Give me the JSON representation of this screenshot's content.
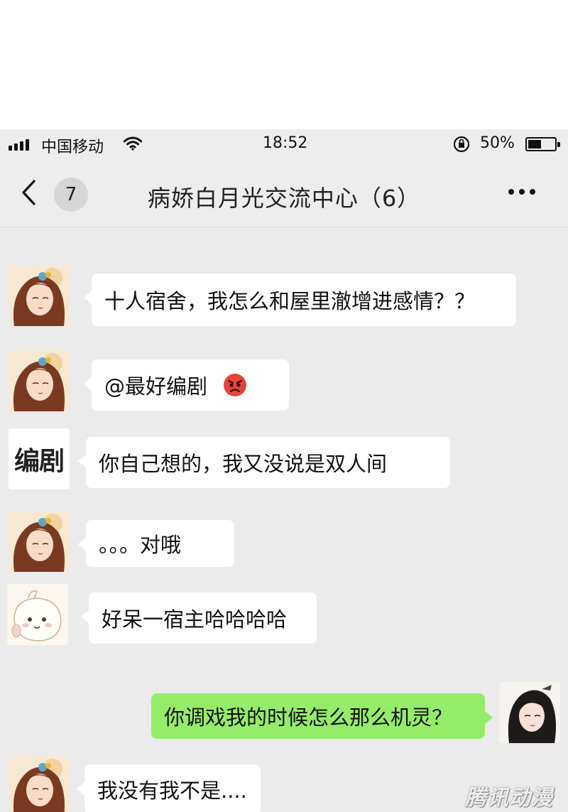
{
  "status_bar": {
    "carrier": "中国移动",
    "time": "18:52",
    "battery": "50%"
  },
  "nav": {
    "unread_count": "7",
    "title": "病娇白月光交流中心（6）"
  },
  "messages": [
    {
      "sender": "heroine",
      "side": "left",
      "text": "十人宿舍，我怎么和屋里澈增进感情？？"
    },
    {
      "sender": "heroine",
      "side": "left",
      "text": "@最好编剧",
      "emoji": "angry-face"
    },
    {
      "sender": "screenwriter",
      "side": "left",
      "avatar_text": "编剧",
      "text": "你自己想的，我又没说是双人间"
    },
    {
      "sender": "heroine",
      "side": "left",
      "text": "。。。对哦"
    },
    {
      "sender": "system",
      "side": "left",
      "text": "好呆一宿主哈哈哈哈"
    },
    {
      "sender": "male-lead",
      "side": "right",
      "text": "你调戏我的时候怎么那么机灵？"
    },
    {
      "sender": "heroine",
      "side": "left",
      "text": "我没有我不是...."
    }
  ],
  "watermark": "腾讯动漫",
  "colors": {
    "chat_background": "#ebebeb",
    "own_bubble": "#95ec69",
    "other_bubble": "#ffffff"
  }
}
